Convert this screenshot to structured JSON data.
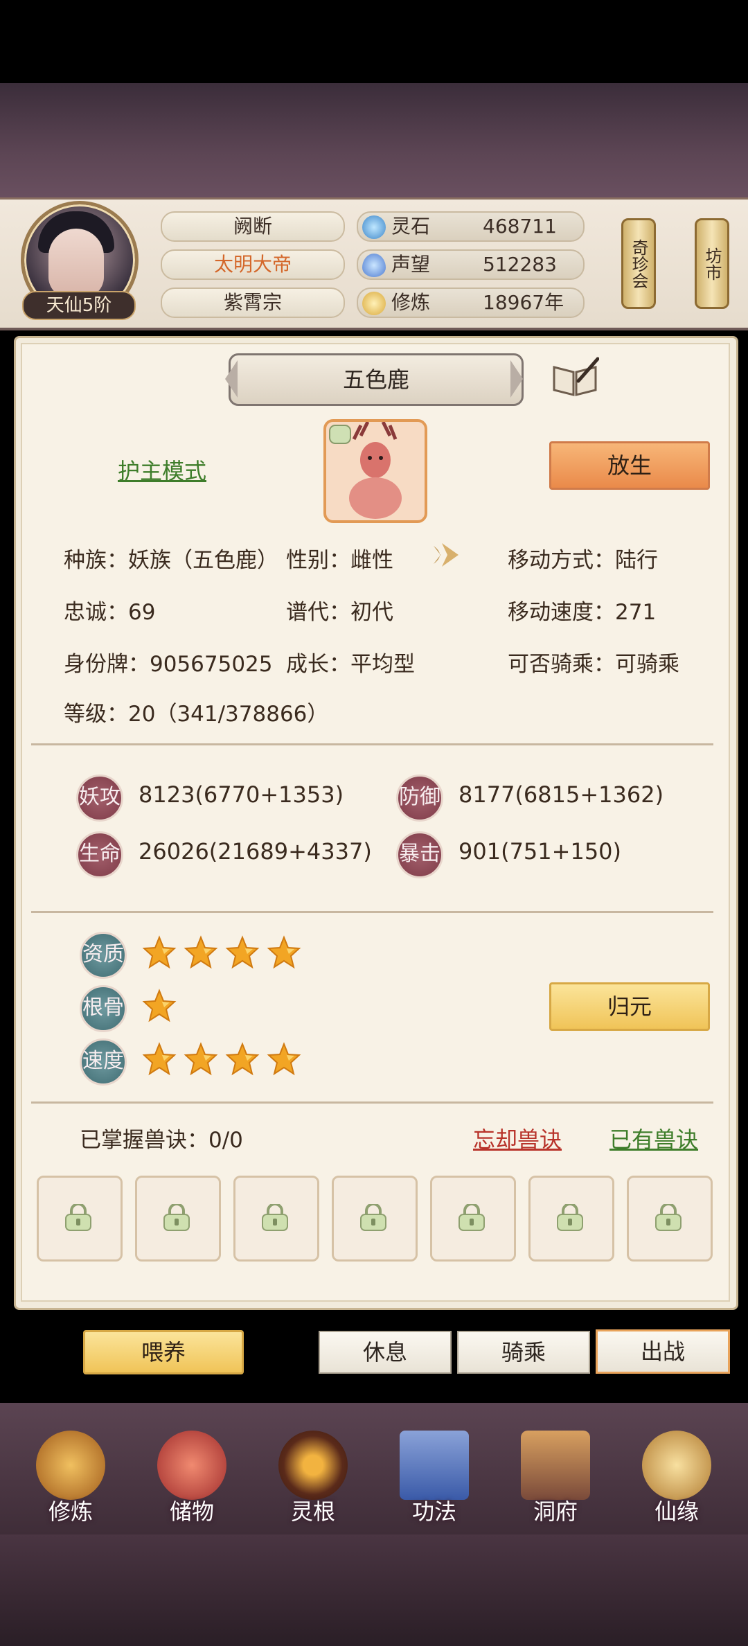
{
  "player": {
    "rank": "天仙5阶",
    "labels": [
      "阙断",
      "太明大帝",
      "紫霄宗"
    ]
  },
  "resources": [
    {
      "icon": "spirit-stone-icon",
      "name": "灵石",
      "value": "468711"
    },
    {
      "icon": "prestige-icon",
      "name": "声望",
      "value": "512283"
    },
    {
      "icon": "cultivation-icon",
      "name": "修炼",
      "value": "18967年"
    }
  ],
  "shops": [
    "奇珍会",
    "坊市"
  ],
  "pet": {
    "name": "五色鹿",
    "mode_link": "护主模式",
    "release_button": "放生",
    "info": {
      "race": "种族：妖族（五色鹿）",
      "gender": "性别：雌性",
      "move_type": "移动方式：陆行",
      "loyalty": "忠诚：69",
      "generation": "谱代：初代",
      "move_speed": "移动速度：271",
      "id_tag": "身份牌：905675025",
      "growth": "成长：平均型",
      "rideable": "可否骑乘：可骑乘",
      "level": "等级：20（341/378866）"
    },
    "stats": [
      {
        "label": "妖攻",
        "value": "8123(6770+1353)"
      },
      {
        "label": "防御",
        "value": "8177(6815+1362)"
      },
      {
        "label": "生命",
        "value": "26026(21689+4337)"
      },
      {
        "label": "暴击",
        "value": "901(751+150)"
      }
    ],
    "qualities": [
      {
        "label": "资质",
        "stars": 4
      },
      {
        "label": "根骨",
        "stars": 1
      },
      {
        "label": "速度",
        "stars": 4
      }
    ],
    "return_button": "归元",
    "skills_mastered": "已掌握兽诀：0/0",
    "forget_link": "忘却兽诀",
    "owned_link": "已有兽诀",
    "skill_slots": 7
  },
  "actions": {
    "feed": "喂养",
    "rest": "休息",
    "ride": "骑乘",
    "battle": "出战"
  },
  "nav": [
    {
      "label": "修炼",
      "icon": "cultivate-icon"
    },
    {
      "label": "储物",
      "icon": "storage-bag-icon"
    },
    {
      "label": "灵根",
      "icon": "spirit-root-icon"
    },
    {
      "label": "功法",
      "icon": "technique-book-icon"
    },
    {
      "label": "洞府",
      "icon": "cave-dwelling-icon"
    },
    {
      "label": "仙缘",
      "icon": "immortal-fate-icon"
    }
  ],
  "colors": {
    "accent_orange": "#ea8a4a",
    "accent_yellow": "#f0c458",
    "link_green": "#3e7d2a",
    "link_red": "#b8332a",
    "title_orange": "#d4672a"
  }
}
